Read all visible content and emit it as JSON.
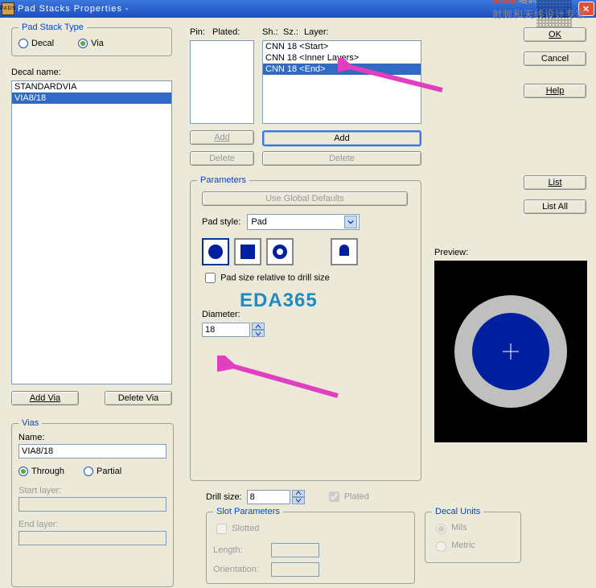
{
  "title": "Pad Stacks Properties -",
  "padStackType": {
    "legend": "Pad Stack Type",
    "decal": "Decal",
    "via": "Via",
    "selected": "via"
  },
  "decalName": {
    "label": "Decal name:",
    "items": [
      "STANDARDVIA",
      "VIA8/18"
    ],
    "selected": 1
  },
  "addVia": "Add Via",
  "deleteVia": "Delete Via",
  "vias": {
    "legend": "Vias",
    "nameLabel": "Name:",
    "name": "VIA8/18",
    "through": "Through",
    "partial": "Partial",
    "selected": "through",
    "startLabel": "Start layer:",
    "endLabel": "End layer:"
  },
  "cols": {
    "pin": "Pin:",
    "plated": "Plated:",
    "sh": "Sh.:",
    "sz": "Sz.:",
    "layer": "Layer:"
  },
  "layerList": {
    "items": [
      "CNN 18 <Start>",
      "CNN 18 <Inner Layers>",
      "CNN 18 <End>"
    ],
    "selected": 2
  },
  "pinBtns": {
    "add": "Add",
    "del": "Delete"
  },
  "layerBtns": {
    "add": "Add",
    "del": "Delete"
  },
  "params": {
    "legend": "Parameters",
    "useGlobal": "Use Global Defaults",
    "padStyleLabel": "Pad style:",
    "padStyle": "Pad",
    "relCheckbox": "Pad size relative to drill size",
    "diameterLabel": "Diameter:",
    "diameter": "18"
  },
  "right": {
    "ok": "OK",
    "cancel": "Cancel",
    "help": "Help",
    "list": "List",
    "listAll": "List All"
  },
  "preview": {
    "label": "Preview:"
  },
  "drill": {
    "label": "Drill size:",
    "value": "8",
    "platedLabel": "Plated"
  },
  "slot": {
    "legend": "Slot Parameters",
    "slotted": "Slotted",
    "length": "Length:",
    "orient": "Orientation:"
  },
  "units": {
    "legend": "Decal Units",
    "mils": "Mils",
    "metric": "Metric"
  },
  "watermark": "EDA365",
  "brand": {
    "l1a": "易迪拓",
    "l1b": "培训",
    "l2": "射频和天线设计专家"
  }
}
